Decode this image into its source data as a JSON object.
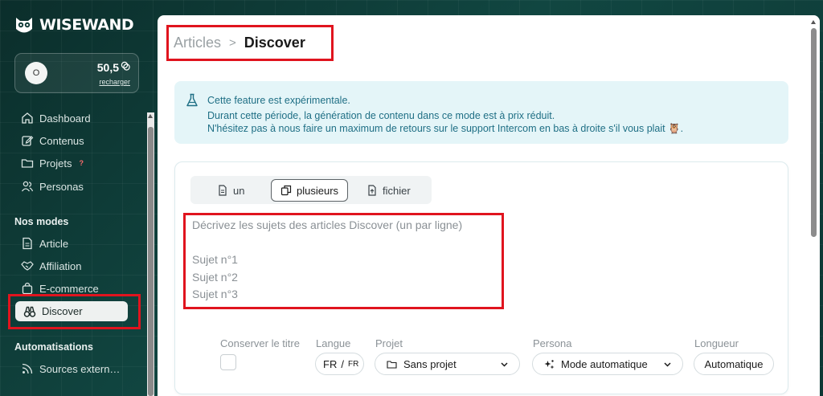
{
  "brand": {
    "name": "WISEWAND"
  },
  "account": {
    "avatar_initial": "O",
    "credits": "50,5",
    "recharge_label": "recharger"
  },
  "sidebar": {
    "items": [
      {
        "label": "Dashboard",
        "icon": "home-icon"
      },
      {
        "label": "Contenus",
        "icon": "edit-icon"
      },
      {
        "label": "Projets",
        "icon": "folder-icon",
        "badge": "?"
      },
      {
        "label": "Personas",
        "icon": "users-icon"
      }
    ],
    "modes_title": "Nos modes",
    "modes": [
      {
        "label": "Article",
        "icon": "document-icon"
      },
      {
        "label": "Affiliation",
        "icon": "handshake-icon"
      },
      {
        "label": "E-commerce",
        "icon": "shopping-bag-icon"
      },
      {
        "label": "Discover",
        "icon": "binoculars-icon",
        "active": true
      }
    ],
    "automations_title": "Automatisations",
    "automations": [
      {
        "label": "Sources extern…",
        "icon": "rss-icon"
      }
    ]
  },
  "breadcrumb": {
    "parent": "Articles",
    "separator": ">",
    "current": "Discover"
  },
  "notice": {
    "title": "Cette feature est expérimentale.",
    "line1": "Durant cette période, la génération de contenu dans ce mode est à prix réduit.",
    "line2": "N'hésitez pas à nous faire un maximum de retours sur le support Intercom en bas à droite s'il vous plait 🦉."
  },
  "tabs": [
    {
      "label": "un",
      "icon": "file-icon"
    },
    {
      "label": "plusieurs",
      "icon": "copy-icon",
      "active": true
    },
    {
      "label": "fichier",
      "icon": "file-upload-icon"
    }
  ],
  "topics_input": {
    "placeholder": "Décrivez les sujets des articles Discover (un par ligne)\n\nSujet n°1\nSujet n°2\nSujet n°3"
  },
  "options": {
    "keep_title_label": "Conserver le titre",
    "language_label": "Langue",
    "language_value": "FR",
    "language_separator": "/",
    "language_secondary": "FR",
    "project_label": "Projet",
    "project_value": "Sans projet",
    "persona_label": "Persona",
    "persona_value": "Mode automatique",
    "length_label": "Longueur",
    "length_value": "Automatique"
  },
  "colors": {
    "accent_red": "#e0141e",
    "sidebar_bg": "#0f3a36",
    "notice_bg": "#e4f5f8",
    "notice_text": "#1f6f85"
  }
}
